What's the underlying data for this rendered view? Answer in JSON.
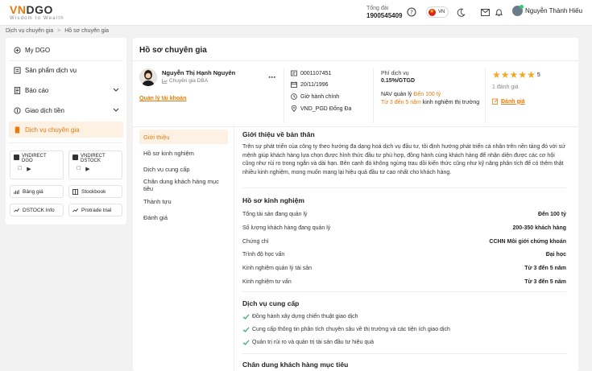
{
  "header": {
    "brand_vn": "VN",
    "brand_dgo": "DGO",
    "tagline": "Wisdom to Wealth",
    "hotline_label": "Tổng đài",
    "hotline_number": "1900545409",
    "language": "VN",
    "user_name": "Nguyễn Thành Hiếu"
  },
  "breadcrumb": [
    "Dịch vụ chuyên gia",
    "Hồ sơ chuyên gia"
  ],
  "sidebar": {
    "items": [
      {
        "label": "My DGO",
        "icon": "my-dgo-icon"
      },
      {
        "label": "Sản phẩm dịch vụ",
        "icon": "product-icon"
      },
      {
        "label": "Báo cáo",
        "icon": "report-icon"
      },
      {
        "label": "Giao dịch tiền",
        "icon": "money-transaction-icon"
      },
      {
        "label": "Dịch vụ chuyên gia",
        "icon": "expert-service-icon"
      }
    ],
    "apps": [
      {
        "line1": "VNDIRECT",
        "line2": "DGO"
      },
      {
        "line1": "VNDIRECT",
        "line2": "DSTOCK"
      }
    ],
    "tools": [
      "Bảng giá",
      "Stockbook",
      "DSTOCK Info",
      "Protrade trial"
    ]
  },
  "main": {
    "title": "Hồ sơ chuyên gia",
    "expert": {
      "name": "Nguyễn Thị Hạnh Nguyên",
      "role": "Chuyên gia DBA",
      "manage_link": "Quản lý tài khoản",
      "account": "0001107451",
      "dob": "20/11/1996",
      "hours": "Giờ hành chính",
      "branch": "VND_PGD Đống Đa"
    },
    "fee": {
      "label": "Phí dịch vụ",
      "value": "0.15%/GTGD",
      "nav_label": "NAV quản lý",
      "nav_value": "Đến 100 tỷ",
      "exp_value": "Từ 3 đến 5 năm",
      "exp_label": "kinh nghiệm thị trường"
    },
    "rating": {
      "score": "5",
      "count": "1 đánh giá",
      "link": "Đánh giá"
    },
    "tabs": [
      "Giới thiệu",
      "Hồ sơ kinh nghiệm",
      "Dịch vụ cung cấp",
      "Chân dung khách hàng mục tiêu",
      "Thành tựu",
      "Đánh giá"
    ],
    "intro": {
      "title": "Giới thiệu về bản thân",
      "text": "Trên sự phát triển của công ty theo hướng đa dạng hoá dịch vụ đầu tư, tôi định hướng phát triển cá nhân trên nền tảng đó với sứ mệnh giúp khách hàng lựa chọn được hình thức đầu tư phù hợp, đồng hành cùng khách hàng để nhận diện được các cơ hội cũng như rủi ro trong ngắn và dài hạn. Bên cạnh đó không ngừng trau dồi kiến thức cũng như kỹ năng phân tích để có thêm thật nhiều kinh nghiệm, mong muốn mang lại hiệu quả đầu tư cao nhất cho khách hàng."
    },
    "experience": {
      "title": "Hồ sơ kinh nghiệm",
      "rows": [
        {
          "k": "Tổng tài sản đang quản lý",
          "v": "Đến 100 tỷ"
        },
        {
          "k": "Số lượng khách hàng đang quản lý",
          "v": "200-350 khách hàng"
        },
        {
          "k": "Chứng chỉ",
          "v": "CCHN Môi giới chứng khoán"
        },
        {
          "k": "Trình độ học vấn",
          "v": "Đại học"
        },
        {
          "k": "Kinh nghiệm quản lý tài sản",
          "v": "Từ 3 đến 5 năm"
        },
        {
          "k": "Kinh nghiệm tư vấn",
          "v": "Từ 3 đến 5 năm"
        }
      ]
    },
    "services": {
      "title": "Dịch vụ cung cấp",
      "items": [
        "Đồng hành xây dựng chiến thuật giao dịch",
        "Cung cấp thông tin phân tích chuyên sâu về thị trường và các tiện ích giao dịch",
        "Quản trị rủi ro và quản trị tài sản đầu tư hiệu quả"
      ]
    },
    "target": {
      "title": "Chân dung khách hàng mục tiêu"
    }
  },
  "colors": {
    "accent": "#e87a0c",
    "star": "#f5a623",
    "check": "#27ae60"
  }
}
